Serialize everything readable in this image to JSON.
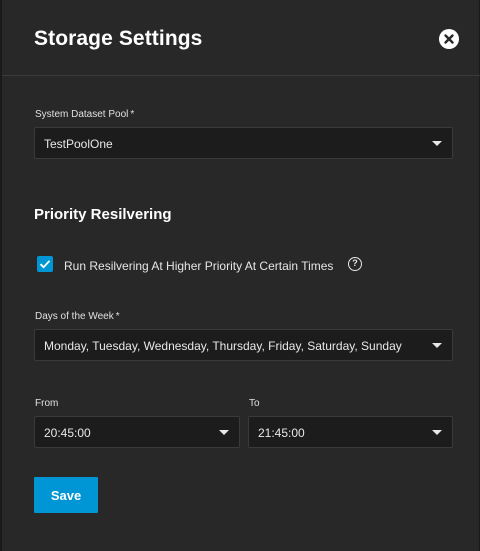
{
  "dialog": {
    "title": "Storage Settings",
    "close_icon": "close-circle-icon"
  },
  "system_dataset_pool": {
    "label": "System Dataset Pool",
    "required_mark": "*",
    "value": "TestPoolOne"
  },
  "priority_resilvering": {
    "section_title": "Priority Resilvering",
    "checkbox": {
      "label": "Run Resilvering At Higher Priority At Certain Times",
      "checked": true,
      "help_glyph": "?"
    },
    "days_of_week": {
      "label": "Days of the Week",
      "required_mark": "*",
      "value": "Monday, Tuesday, Wednesday, Thursday, Friday, Saturday, Sunday"
    },
    "from": {
      "label": "From",
      "value": "20:45:00"
    },
    "to": {
      "label": "To",
      "value": "21:45:00"
    }
  },
  "actions": {
    "save_label": "Save"
  },
  "colors": {
    "accent": "#0095d5",
    "background": "#282828",
    "input_background": "#1c1c1c"
  }
}
